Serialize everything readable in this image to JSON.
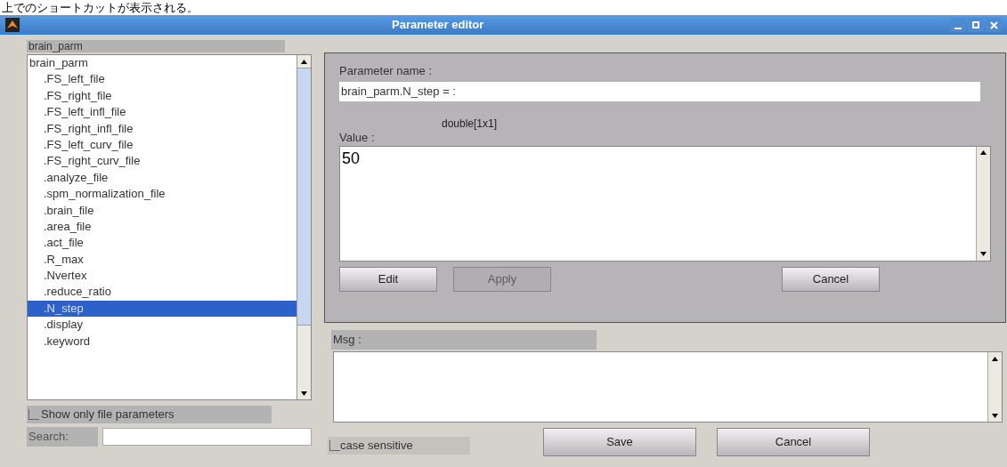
{
  "caption": "上でのショートカットが表示される。",
  "window": {
    "title": "Parameter editor"
  },
  "tree": {
    "header": "brain_parm",
    "root": {
      "label": "brain_parm",
      "selected": false,
      "children": [
        {
          "label": ".FS_left_file",
          "selected": false
        },
        {
          "label": ".FS_right_file",
          "selected": false
        },
        {
          "label": ".FS_left_infl_file",
          "selected": false
        },
        {
          "label": ".FS_right_infl_file",
          "selected": false
        },
        {
          "label": ".FS_left_curv_file",
          "selected": false
        },
        {
          "label": ".FS_right_curv_file",
          "selected": false
        },
        {
          "label": ".analyze_file",
          "selected": false
        },
        {
          "label": ".spm_normalization_file",
          "selected": false
        },
        {
          "label": ".brain_file",
          "selected": false
        },
        {
          "label": ".area_file",
          "selected": false
        },
        {
          "label": ".act_file",
          "selected": false
        },
        {
          "label": ".R_max",
          "selected": false
        },
        {
          "label": ".Nvertex",
          "selected": false
        },
        {
          "label": ".reduce_ratio",
          "selected": false
        },
        {
          "label": ".N_step",
          "selected": true
        },
        {
          "label": ".display",
          "selected": false
        },
        {
          "label": ".keyword",
          "selected": false
        }
      ]
    }
  },
  "show_only_file_parameters": {
    "label": "Show only file parameters",
    "checked": false
  },
  "search": {
    "label": "Search:"
  },
  "case_sensitive": {
    "label": "case sensitive",
    "checked": false
  },
  "editor": {
    "name_label": "Parameter name :",
    "name_value": "brain_parm.N_step = :",
    "type": "double[1x1]",
    "value_label": "Value :",
    "value": "50",
    "buttons": [
      {
        "label": "Edit",
        "disabled": false
      },
      {
        "label": "Apply",
        "disabled": true
      },
      {
        "label": "Cancel",
        "disabled": false
      }
    ]
  },
  "msg": {
    "label": "Msg :"
  },
  "bottom_buttons": [
    "Save",
    "Cancel"
  ]
}
